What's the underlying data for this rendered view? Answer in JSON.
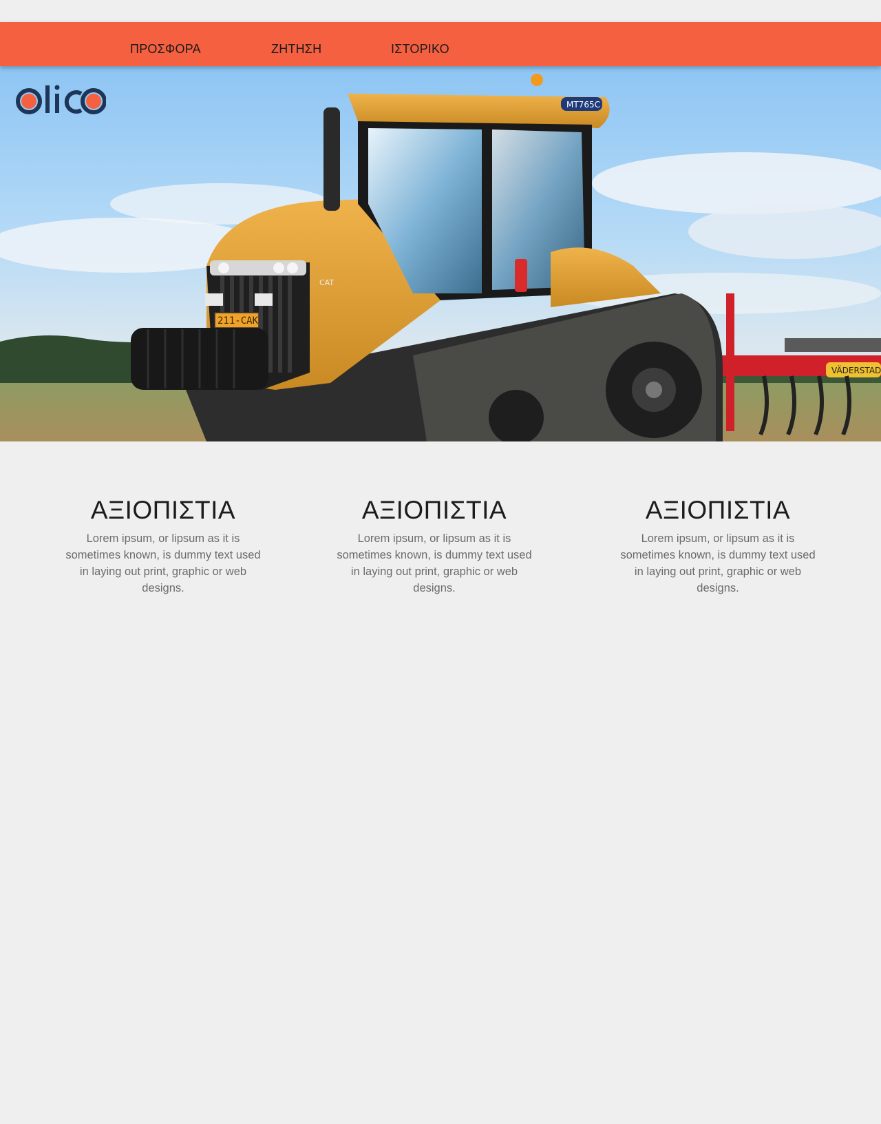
{
  "nav": {
    "items": [
      {
        "label": "ΠΡΟΣΦΟΡΑ"
      },
      {
        "label": "ΖΗΤΗΣΗ"
      },
      {
        "label": "ΙΣΤΟΡΙΚΟ"
      }
    ]
  },
  "logo": {
    "text": "olico"
  },
  "hero": {
    "plate": "211-CAK",
    "model": "MT765C",
    "cab_badge": "CAT",
    "implement_brand": "VÄDERSTAD"
  },
  "features": [
    {
      "title": "ΑΞΙΟΠΙΣΤΙΑ",
      "text": "Lorem ipsum, or lipsum as it is sometimes known, is dummy text used in laying out print, graphic or web designs."
    },
    {
      "title": "ΑΞΙΟΠΙΣΤΙΑ",
      "text": "Lorem ipsum, or lipsum as it is sometimes known, is dummy text used in laying out print, graphic or web designs."
    },
    {
      "title": "ΑΞΙΟΠΙΣΤΙΑ",
      "text": "Lorem ipsum, or lipsum as it is sometimes known, is dummy text used in laying out print, graphic or web designs."
    }
  ],
  "colors": {
    "navbar": "#f56040",
    "logo_dark": "#1d3557",
    "logo_accent": "#f56040",
    "background": "#efefef"
  }
}
